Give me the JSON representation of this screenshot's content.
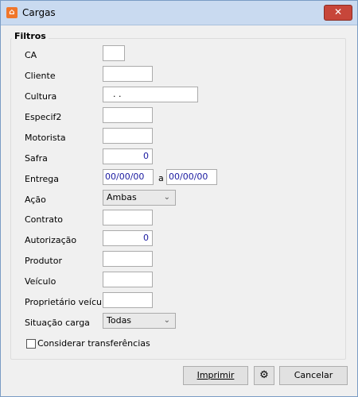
{
  "window": {
    "title": "Cargas",
    "close_label": "✕"
  },
  "group": {
    "title": "Filtros"
  },
  "fields": {
    "ca": {
      "label": "CA",
      "value": ""
    },
    "cliente": {
      "label": "Cliente",
      "value": ""
    },
    "cultura": {
      "label": "Cultura",
      "value": ".  ."
    },
    "especif2": {
      "label": "Especif2",
      "value": ""
    },
    "motorista": {
      "label": "Motorista",
      "value": ""
    },
    "safra": {
      "label": "Safra",
      "value": "0"
    },
    "entrega": {
      "label": "Entrega",
      "from": "00/00/00",
      "sep": "a",
      "to": "00/00/00"
    },
    "acao": {
      "label": "Ação",
      "selected": "Ambas"
    },
    "contrato": {
      "label": "Contrato",
      "value": ""
    },
    "autorizacao": {
      "label": "Autorização",
      "value": "0"
    },
    "produtor": {
      "label": "Produtor",
      "value": ""
    },
    "veiculo": {
      "label": "Veículo",
      "value": ""
    },
    "proprietario": {
      "label": "Proprietário veículo",
      "value": ""
    },
    "situacao": {
      "label": "Situação carga",
      "selected": "Todas"
    }
  },
  "checkbox": {
    "label": "Considerar transferências",
    "checked": false
  },
  "buttons": {
    "print": "Imprimir",
    "cancel": "Cancelar"
  }
}
